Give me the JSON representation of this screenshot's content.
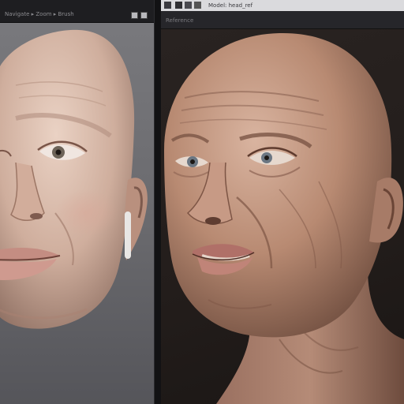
{
  "left_panel": {
    "toolbar_label": "Navigate ▸ Zoom ▸ Brush",
    "buttons": [
      "minimize",
      "maximize",
      "close"
    ]
  },
  "right_panel": {
    "toolbar_label": "Model: head_ref",
    "subbar_label": "Reference"
  },
  "colors": {
    "left_bg": "#6f6f73",
    "right_bg": "#241e1c",
    "toolbar": "#1e1e21",
    "skin_light": "#e2c3b2",
    "skin_dark": "#b88a72"
  },
  "icons": [
    "app-icon",
    "layers-icon",
    "brush-icon",
    "camera-icon"
  ]
}
